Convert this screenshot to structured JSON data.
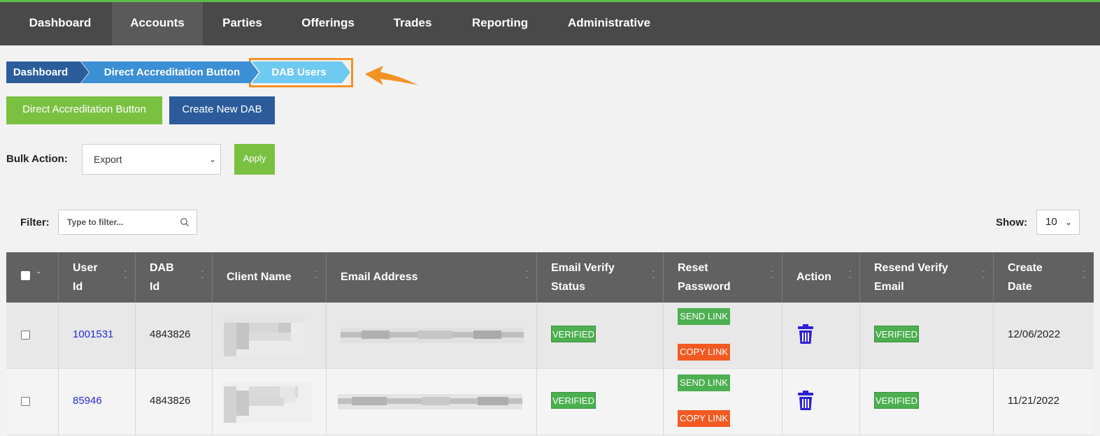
{
  "nav": {
    "items": [
      "Dashboard",
      "Accounts",
      "Parties",
      "Offerings",
      "Trades",
      "Reporting",
      "Administrative"
    ],
    "active": "Accounts"
  },
  "breadcrumb": [
    "Dashboard",
    "Direct Accreditation Button",
    "DAB Users"
  ],
  "buttons": {
    "direct_accreditation": "Direct Accreditation Button",
    "create_new_dab": "Create New DAB",
    "apply": "Apply"
  },
  "bulk_action": {
    "label": "Bulk Action:",
    "selected": "Export"
  },
  "filter": {
    "label": "Filter:",
    "placeholder": "Type to filter..."
  },
  "show": {
    "label": "Show:",
    "value": "10"
  },
  "table": {
    "headers": [
      "User Id",
      "DAB Id",
      "Client Name",
      "Email Address",
      "Email Verify Status",
      "Reset Password",
      "Action",
      "Resend Verify Email",
      "Create Date"
    ],
    "rows": [
      {
        "user_id": "1001531",
        "dab_id": "4843826",
        "email_verify_status": "VERIFIED",
        "send_link": "SEND LINK",
        "copy_link": "COPY LINK",
        "resend_verify": "VERIFIED",
        "create_date": "12/06/2022"
      },
      {
        "user_id": "85946",
        "dab_id": "4843826",
        "email_verify_status": "VERIFIED",
        "send_link": "SEND LINK",
        "copy_link": "COPY LINK",
        "resend_verify": "VERIFIED",
        "create_date": "11/21/2022"
      }
    ]
  },
  "colors": {
    "nav_bg": "#494949",
    "accent_green": "#7ac142",
    "accent_blue": "#2b5b9b",
    "highlight_orange": "#f39224",
    "verified_green": "#4caf50",
    "copy_orange": "#f25a22",
    "link_blue": "#2a2ad8"
  }
}
